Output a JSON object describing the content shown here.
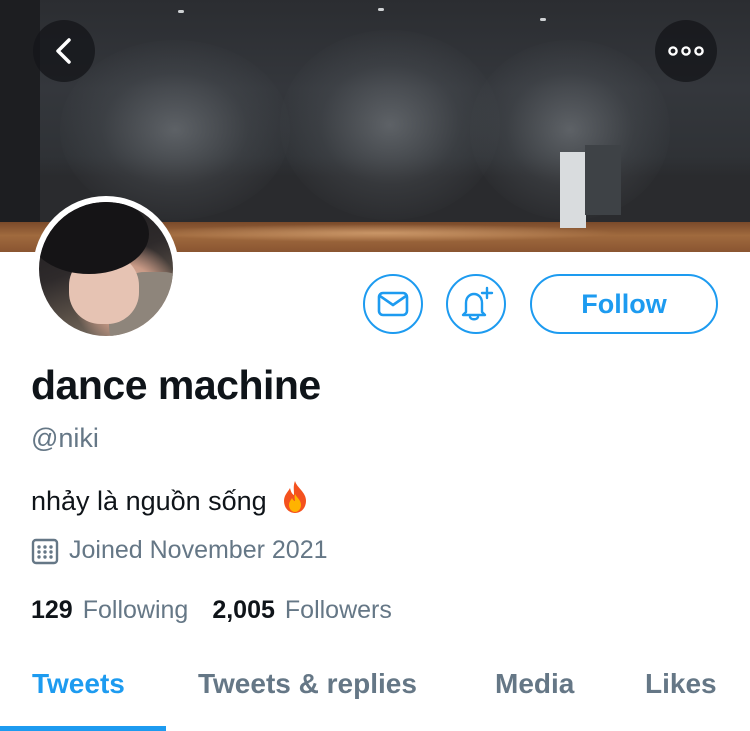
{
  "profile": {
    "display_name": "dance machine",
    "handle": "@niki",
    "bio": "nhảy là nguồn sống",
    "bio_emoji": "fire-emoji",
    "joined": "Joined November 2021"
  },
  "stats": {
    "following_count": "129",
    "following_label": "Following",
    "followers_count": "2,005",
    "followers_label": "Followers"
  },
  "actions": {
    "follow_label": "Follow"
  },
  "header": {
    "back_icon": "chevron-left-icon",
    "more_icon": "more-horizontal-icon"
  },
  "tabs": [
    {
      "label": "Tweets",
      "active": true
    },
    {
      "label": "Tweets & replies",
      "active": false
    },
    {
      "label": "Media",
      "active": false
    },
    {
      "label": "Likes",
      "active": false
    }
  ],
  "colors": {
    "accent": "#1d9bf0",
    "secondary_text": "#657786",
    "primary_text": "#0f1419"
  }
}
